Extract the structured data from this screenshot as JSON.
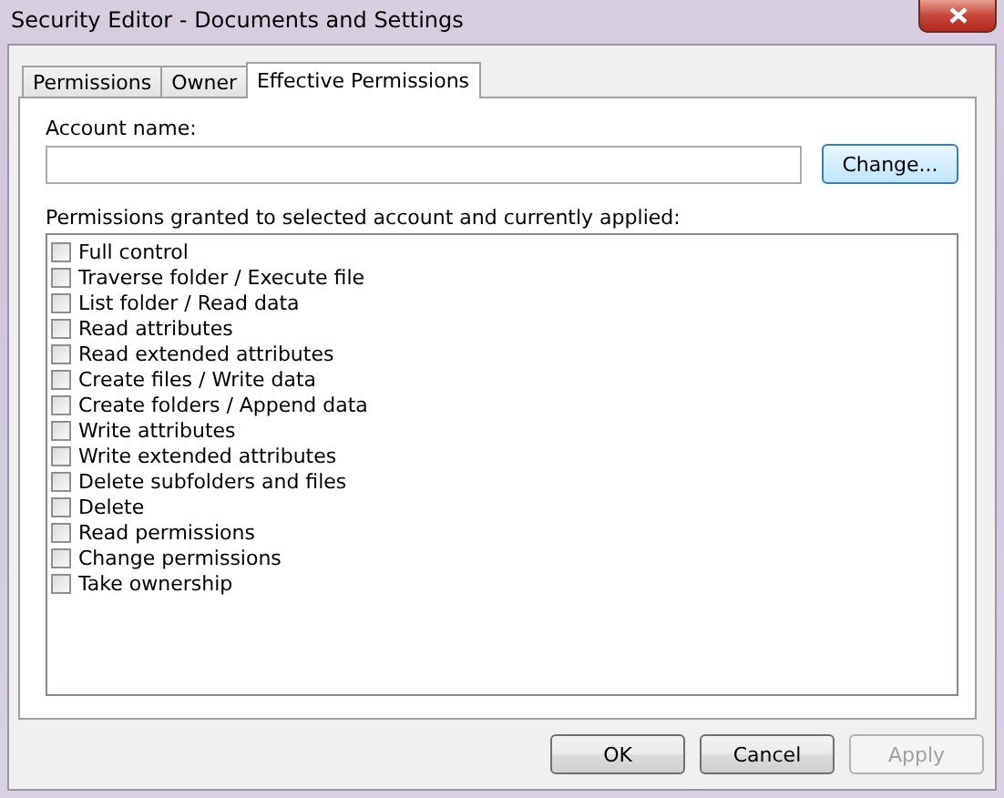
{
  "window": {
    "title": "Security Editor - Documents and Settings"
  },
  "tabs": [
    {
      "label": "Permissions",
      "selected": false
    },
    {
      "label": "Owner",
      "selected": false
    },
    {
      "label": "Effective Permissions",
      "selected": true
    }
  ],
  "account": {
    "label": "Account name:",
    "change_button": "Change..."
  },
  "permissions": {
    "label": "Permissions granted to selected account and currently applied:",
    "items": [
      {
        "label": "Full control",
        "checked": false
      },
      {
        "label": "Traverse folder / Execute file",
        "checked": false
      },
      {
        "label": "List folder / Read data",
        "checked": false
      },
      {
        "label": "Read attributes",
        "checked": false
      },
      {
        "label": "Read extended attributes",
        "checked": false
      },
      {
        "label": "Create files / Write data",
        "checked": false
      },
      {
        "label": "Create folders / Append data",
        "checked": false
      },
      {
        "label": "Write attributes",
        "checked": false
      },
      {
        "label": "Write extended attributes",
        "checked": false
      },
      {
        "label": "Delete subfolders and files",
        "checked": false
      },
      {
        "label": "Delete",
        "checked": false
      },
      {
        "label": "Read permissions",
        "checked": false
      },
      {
        "label": "Change permissions",
        "checked": false
      },
      {
        "label": "Take ownership",
        "checked": false
      }
    ]
  },
  "buttons": [
    {
      "label": "OK",
      "disabled": false
    },
    {
      "label": "Cancel",
      "disabled": false
    },
    {
      "label": "Apply",
      "disabled": true
    }
  ]
}
